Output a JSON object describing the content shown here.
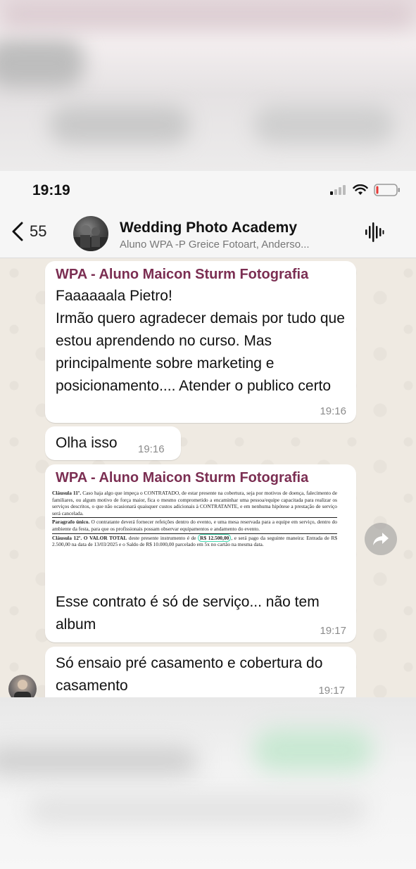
{
  "status_bar": {
    "time": "19:19"
  },
  "header": {
    "back_count": "55",
    "group_name": "Wedding Photo Academy",
    "members": "Aluno WPA -P  Greice Fotoart, Anderso..."
  },
  "messages": [
    {
      "sender": "WPA - Aluno Maicon Sturm Fotografia",
      "text": "Faaaaaala Pietro!\nIrmão quero agradecer demais por tudo que estou aprendendo no curso. Mas principalmente sobre marketing e posicionamento.... Atender o publico certo",
      "time": "19:16"
    },
    {
      "text": "Olha isso",
      "time": "19:16"
    },
    {
      "sender": "WPA - Aluno Maicon Sturm Fotografia",
      "doc": {
        "c11_label": "Cláusula 11º.",
        "c11_text": " Caso haja algo que impeça o CONTRATADO, de estar presente na cobertura, seja por motivos de doença, falecimento de familiares, ou algum motivo de força maior, fica o mesmo comprometido a encaminhar uma pessoa/equipe capacitada para realizar os serviços descritos, o que não ocasionará quaisquer custos adicionais à CONTRATANTE, e em nenhuma hipótese a prestação de serviço será cancelada.",
        "par_label": "Paragrafo único.",
        "par_text": " O contratante deverá fornecer refeições dentro do evento, e uma mesa reservada para a equipe em serviço, dentro do ambiente da festa, para que os profissionais possam observar equipamentos e andamento do evento.",
        "c12_label": "Cláusula 12º. O VALOR TOTAL",
        "c12_pre": " deste presente instrumento é de ",
        "c12_value": "R$ 12.500,00",
        "c12_post": ", e será pago da seguinte maneira: Entrada de R$ 2.500,00 na data de 13/03/2025 e o Saldo de R$ 10.000,00 parcelado em 5x no cartão na mesma data."
      },
      "text": "Esse contrato é só de serviço... não tem album",
      "time": "19:17"
    },
    {
      "text": "Só ensaio pré casamento e cobertura do casamento",
      "time": "19:17"
    }
  ]
}
